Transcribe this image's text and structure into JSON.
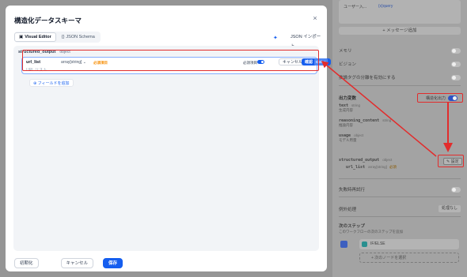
{
  "modal": {
    "title": "構造化データスキーマ",
    "close_label": "×",
    "tabs": [
      {
        "label": "Visual Editor",
        "icon": "layout-icon",
        "active": true
      },
      {
        "label": "JSON Schema",
        "icon": "braces-icon",
        "active": false
      }
    ],
    "generate_icon": "sparkle-icon",
    "import_label": "JSON インポート",
    "root": {
      "name": "structured_output",
      "type": "object"
    },
    "field": {
      "name": "url_list",
      "type": "array[string]",
      "required_tag": "必須項目",
      "description": "URL リスト",
      "required_label": "必須項目",
      "required_on": true,
      "cancel_label": "キャンセル",
      "confirm_label": "確認",
      "confirm_shortcut": "Ctrl ↵"
    },
    "add_field_label": "フィールドを追加",
    "footer": {
      "reset_label": "初期化",
      "cancel_label": "キャンセル",
      "save_label": "保存"
    }
  },
  "background": {
    "card_top_text": "ユーザー入...",
    "card_top_badge": "{x}query",
    "add_message_label": "+ メッセージ追加",
    "memory_label": "メモリ",
    "vision_label": "ビジョン",
    "xml_label": "推論タグの分離を有効にする",
    "output_vars_title": "出力変数",
    "structured_output_label": "構造化出力",
    "structured_output_on": true,
    "vars": [
      {
        "name": "text",
        "type": "string",
        "desc": "生成内容"
      },
      {
        "name": "reasoning_content",
        "type": "string",
        "desc": "推論内容"
      },
      {
        "name": "usage",
        "type": "object",
        "desc": "モデル用量"
      }
    ],
    "structured_var": {
      "name": "structured_output",
      "type": "object"
    },
    "structured_child": {
      "name": "url_list",
      "type": "array[string]",
      "required": "必須"
    },
    "settings_label": "設定",
    "error_retry_label": "失敗時再試行",
    "error_handling_label": "例外処理",
    "error_handling_value": "処理なし",
    "next_step_title": "次のステップ",
    "next_step_desc": "このワークフローの次のステップを追加",
    "next_node_label": "IF/ELSE",
    "select_next_label": "+ 次のノードを選択"
  },
  "colors": {
    "accent": "#155eef",
    "annotation": "#e22c2c"
  }
}
